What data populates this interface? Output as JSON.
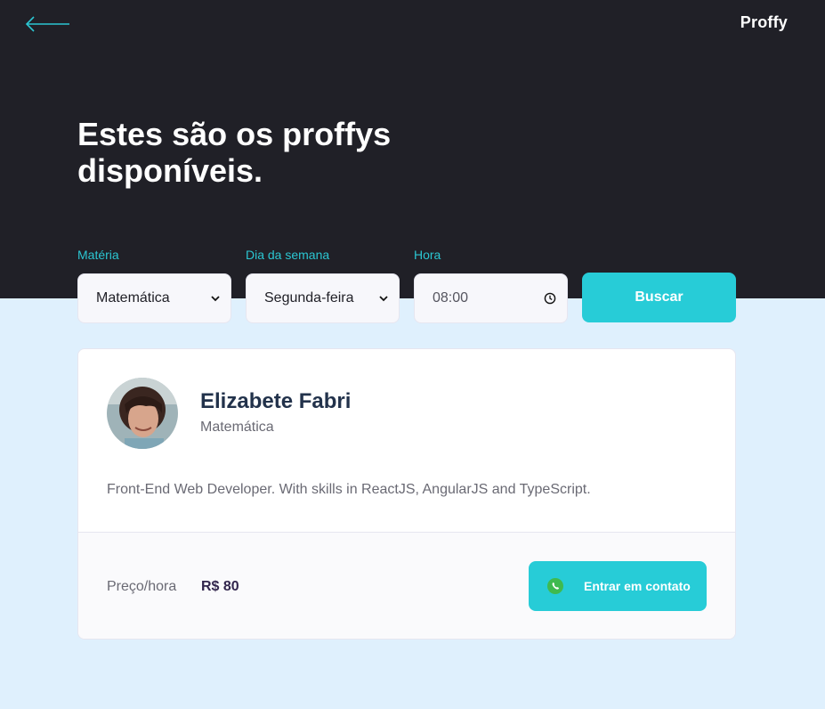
{
  "header": {
    "back_icon": "arrow-left-icon",
    "logo": "Proffy",
    "title": "Estes são os proffys disponíveis."
  },
  "filters": {
    "subject": {
      "label": "Matéria",
      "value": "Matemática"
    },
    "weekday": {
      "label": "Dia da semana",
      "value": "Segunda-feira"
    },
    "time": {
      "label": "Hora",
      "value": "08:00"
    },
    "search_label": "Buscar"
  },
  "teacher": {
    "name": "Elizabete Fabri",
    "subject": "Matemática",
    "bio": "Front-End Web Developer. With skills in ReactJS, AngularJS and TypeScript.",
    "price_label": "Preço/hora",
    "price": "R$ 80",
    "contact_label": "Entrar em contato",
    "contact_icon": "whatsapp-icon"
  },
  "colors": {
    "hero_bg": "#202027",
    "page_bg": "#dff0fd",
    "accent": "#27ccd7"
  }
}
